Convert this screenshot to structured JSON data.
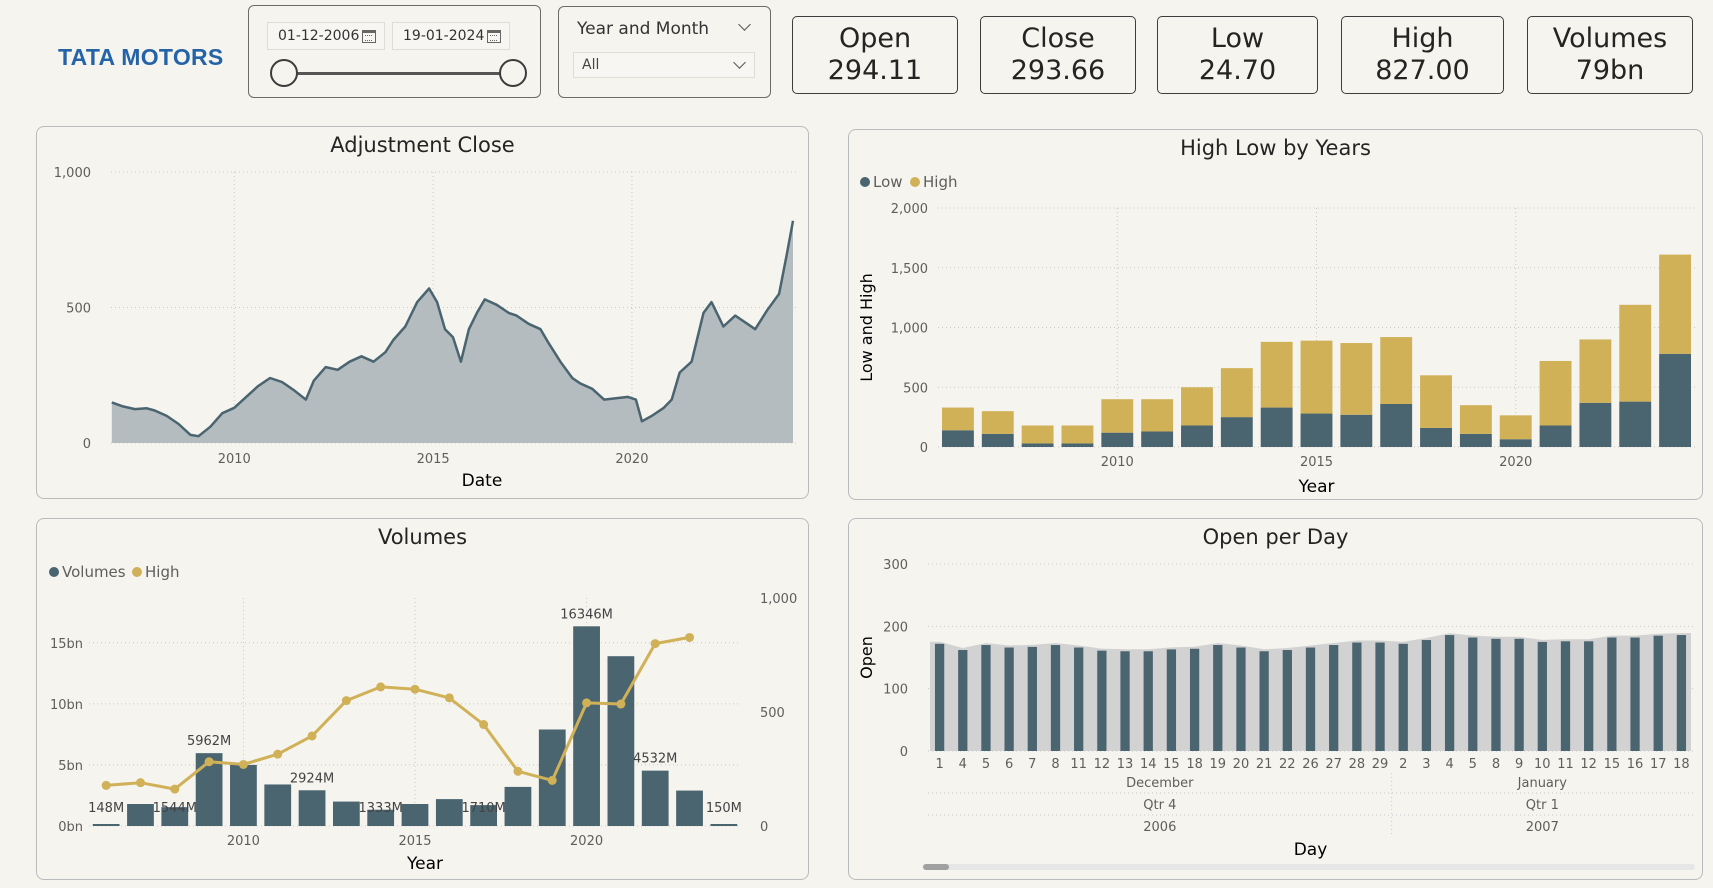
{
  "logo": "TATA MOTORS",
  "filters": {
    "start_date": "01-12-2006",
    "end_date": "19-01-2024",
    "dropdown_title": "Year and Month",
    "dropdown_value": "All"
  },
  "kpis": [
    {
      "label": "Open",
      "value": "294.11"
    },
    {
      "label": "Close",
      "value": "293.66"
    },
    {
      "label": "Low",
      "value": "24.70"
    },
    {
      "label": "High",
      "value": "827.00"
    },
    {
      "label": "Volumes",
      "value": "79bn"
    }
  ],
  "colors": {
    "dark_series": "#4a6470",
    "gold_series": "#d0b158",
    "area_fill": "#b4bcbf",
    "gray_bar": "#d2d2d2",
    "logo_blue": "#2563a8"
  },
  "chart_data": [
    {
      "id": "adj-close",
      "type": "area",
      "title": "Adjustment Close",
      "xlabel": "Date",
      "ylabel": "",
      "x_ticks": [
        "2010",
        "2015",
        "2020"
      ],
      "y_ticks": [
        "0",
        "500",
        "1,000"
      ],
      "xlim": [
        2006.9,
        2024.05
      ],
      "ylim": [
        0,
        1000
      ],
      "grid": true,
      "x": [
        2006.92,
        2007.2,
        2007.5,
        2007.8,
        2008.0,
        2008.3,
        2008.6,
        2008.9,
        2009.1,
        2009.4,
        2009.7,
        2010.0,
        2010.3,
        2010.6,
        2010.9,
        2011.2,
        2011.5,
        2011.8,
        2012.0,
        2012.3,
        2012.6,
        2012.9,
        2013.2,
        2013.5,
        2013.8,
        2014.0,
        2014.3,
        2014.6,
        2014.9,
        2015.1,
        2015.3,
        2015.5,
        2015.7,
        2015.9,
        2016.1,
        2016.3,
        2016.6,
        2016.9,
        2017.1,
        2017.4,
        2017.7,
        2017.9,
        2018.2,
        2018.5,
        2018.7,
        2019.0,
        2019.3,
        2019.6,
        2019.9,
        2020.1,
        2020.25,
        2020.5,
        2020.8,
        2021.0,
        2021.2,
        2021.5,
        2021.8,
        2022.0,
        2022.3,
        2022.6,
        2022.9,
        2023.1,
        2023.4,
        2023.7,
        2023.9,
        2024.05
      ],
      "y": [
        150,
        135,
        125,
        128,
        120,
        100,
        70,
        30,
        25,
        60,
        110,
        130,
        170,
        210,
        240,
        225,
        195,
        160,
        230,
        280,
        270,
        300,
        320,
        300,
        335,
        380,
        430,
        520,
        570,
        520,
        420,
        390,
        300,
        420,
        480,
        530,
        510,
        480,
        470,
        440,
        420,
        370,
        300,
        240,
        220,
        200,
        160,
        165,
        170,
        160,
        80,
        100,
        130,
        160,
        260,
        300,
        480,
        520,
        430,
        470,
        440,
        420,
        490,
        550,
        700,
        820
      ]
    },
    {
      "id": "high-low",
      "type": "bar",
      "stacked": true,
      "title": "High Low by Years",
      "xlabel": "Year",
      "ylabel": "Low and High",
      "legend": "top-left",
      "x_ticks": [
        "2010",
        "2015",
        "2020"
      ],
      "y_ticks": [
        "0",
        "500",
        "1,000",
        "1,500",
        "2,000"
      ],
      "ylim": [
        0,
        2000
      ],
      "grid": true,
      "categories": [
        "2006",
        "2007",
        "2008",
        "2009",
        "2010",
        "2011",
        "2012",
        "2013",
        "2014",
        "2015",
        "2016",
        "2017",
        "2018",
        "2019",
        "2020",
        "2021",
        "2022",
        "2023",
        "2024"
      ],
      "series": [
        {
          "name": "Low",
          "values": [
            140,
            110,
            30,
            30,
            120,
            130,
            180,
            250,
            330,
            280,
            270,
            360,
            160,
            110,
            65,
            180,
            370,
            380,
            780
          ]
        },
        {
          "name": "High",
          "values": [
            190,
            190,
            150,
            150,
            280,
            270,
            320,
            410,
            550,
            610,
            600,
            560,
            440,
            240,
            200,
            540,
            530,
            810,
            830
          ]
        }
      ]
    },
    {
      "id": "volumes",
      "type": "bar",
      "title": "Volumes",
      "xlabel": "Year",
      "ylabel": "",
      "legend": "top-left",
      "x_ticks": [
        "2010",
        "2015",
        "2020"
      ],
      "y_ticks": [
        "0bn",
        "5bn",
        "10bn",
        "15bn"
      ],
      "y2_ticks": [
        "0",
        "500",
        "1,000"
      ],
      "ylim": [
        0,
        18.5
      ],
      "y2lim": [
        0,
        1000
      ],
      "grid": true,
      "categories": [
        "2006",
        "2007",
        "2008",
        "2009",
        "2010",
        "2011",
        "2012",
        "2013",
        "2014",
        "2015",
        "2016",
        "2017",
        "2018",
        "2019",
        "2020",
        "2021",
        "2022",
        "2023",
        "2024"
      ],
      "series": [
        {
          "name": "Volumes",
          "type": "bar",
          "values": [
            0.148,
            1.8,
            1.544,
            5.962,
            5.0,
            3.4,
            2.924,
            2.0,
            1.333,
            1.8,
            2.2,
            1.71,
            3.2,
            7.9,
            16.346,
            13.9,
            4.532,
            2.9,
            0.15
          ]
        },
        {
          "name": "High",
          "type": "line",
          "values": [
            178,
            190,
            162,
            282,
            270,
            315,
            395,
            550,
            610,
            600,
            562,
            445,
            240,
            200,
            540,
            535,
            800,
            827,
            null
          ]
        }
      ],
      "data_labels": [
        {
          "index": 0,
          "text": "148M"
        },
        {
          "index": 2,
          "text": "1544M"
        },
        {
          "index": 3,
          "text": "5962M"
        },
        {
          "index": 6,
          "text": "2924M"
        },
        {
          "index": 8,
          "text": "1333M"
        },
        {
          "index": 11,
          "text": "1710M"
        },
        {
          "index": 14,
          "text": "16346M"
        },
        {
          "index": 16,
          "text": "4532M"
        },
        {
          "index": 18,
          "text": "150M"
        }
      ]
    },
    {
      "id": "open-per-day",
      "type": "bar",
      "title": "Open per Day",
      "xlabel": "Day",
      "ylabel": "Open",
      "y_ticks": [
        "0",
        "100",
        "200",
        "300"
      ],
      "ylim": [
        0,
        300
      ],
      "grid": true,
      "categories": [
        "1",
        "4",
        "5",
        "6",
        "7",
        "8",
        "11",
        "12",
        "13",
        "14",
        "15",
        "18",
        "19",
        "20",
        "21",
        "22",
        "26",
        "27",
        "28",
        "29",
        "2",
        "3",
        "4",
        "5",
        "8",
        "9",
        "10",
        "11",
        "12",
        "15",
        "16",
        "17",
        "18"
      ],
      "values": [
        172,
        162,
        170,
        166,
        167,
        170,
        166,
        161,
        160,
        160,
        163,
        164,
        170,
        166,
        160,
        162,
        166,
        170,
        174,
        174,
        172,
        178,
        186,
        182,
        180,
        180,
        175,
        176,
        176,
        182,
        182,
        185,
        186
      ],
      "hierarchy": {
        "months": [
          {
            "label": "December",
            "start": 0,
            "end": 19
          },
          {
            "label": "January",
            "start": 20,
            "end": 32
          }
        ],
        "quarters": [
          {
            "label": "Qtr 4",
            "start": 0,
            "end": 19
          },
          {
            "label": "Qtr 1",
            "start": 20,
            "end": 32
          }
        ],
        "years": [
          {
            "label": "2006",
            "start": 0,
            "end": 19
          },
          {
            "label": "2007",
            "start": 20,
            "end": 32
          }
        ]
      }
    }
  ]
}
